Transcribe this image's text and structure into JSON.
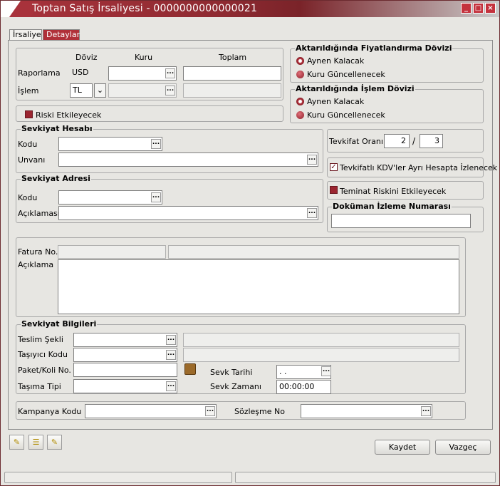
{
  "window": {
    "title": "Toptan Satış İrsaliyesi - 0000000000000021"
  },
  "tabs": [
    {
      "label": "İrsaliye"
    },
    {
      "label": "Detaylar"
    }
  ],
  "currency": {
    "col_doviz": "Döviz",
    "col_kuru": "Kuru",
    "col_toplam": "Toplam",
    "row_raporlama": "Raporlama",
    "row_islem": "İşlem",
    "raporlama_doviz": "USD",
    "islem_doviz": "TL",
    "riski_etkileyecek": "Riski Etkileyecek"
  },
  "fiyat_dovizi": {
    "title": "Aktarıldığında Fiyatlandırma Dövizi",
    "opt1": "Aynen Kalacak",
    "opt2": "Kuru Güncellenecek"
  },
  "islem_dovizi": {
    "title": "Aktarıldığında İşlem Dövizi",
    "opt1": "Aynen Kalacak",
    "opt2": "Kuru Güncellenecek"
  },
  "sevkiyat_hesabi": {
    "title": "Sevkiyat Hesabı",
    "kodu": "Kodu",
    "unvani": "Unvanı"
  },
  "sevkiyat_adresi": {
    "title": "Sevkiyat Adresi",
    "kodu": "Kodu",
    "aciklamasi": "Açıklaması"
  },
  "tevkifat": {
    "label": "Tevkifat Oranı",
    "num": "2",
    "sep": "/",
    "den": "3",
    "kdv_ayri": "Tevkifatlı KDV'ler Ayrı Hesapta İzlenecek"
  },
  "teminat": {
    "label": "Teminat Riskini Etkileyecek"
  },
  "dokuman": {
    "title": "Doküman İzleme Numarası"
  },
  "fatura": {
    "fatura_no": "Fatura No.",
    "aciklama": "Açıklama"
  },
  "sevkiyat_bilgileri": {
    "title": "Sevkiyat Bilgileri",
    "teslim_sekli": "Teslim Şekli",
    "tasiyici_kodu": "Taşıyıcı Kodu",
    "paket": "Paket/Koli No.",
    "tasima_tipi": "Taşıma Tipi",
    "sevk_tarihi": "Sevk Tarihi",
    "sevk_tarihi_val": "  .  .",
    "sevk_zamani": "Sevk Zamanı",
    "sevk_zamani_val": "00:00:00"
  },
  "kampanya": {
    "kodu": "Kampanya Kodu",
    "sozlesme": "Sözleşme No"
  },
  "buttons": {
    "kaydet": "Kaydet",
    "vazgec": "Vazgeç"
  },
  "colors": {
    "accent": "#a8323b",
    "panel": "#e7e6e2"
  }
}
